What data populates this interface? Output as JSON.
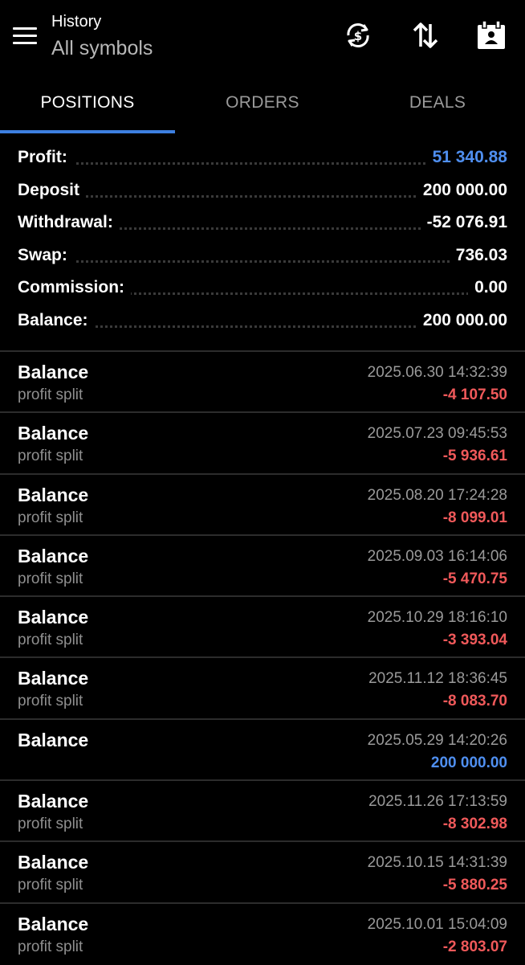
{
  "header": {
    "title": "History",
    "subtitle": "All symbols",
    "icons": [
      "menu-icon",
      "sync-currency-icon",
      "sort-icon",
      "calendar-icon"
    ]
  },
  "tabs": [
    {
      "label": "POSITIONS",
      "active": true
    },
    {
      "label": "ORDERS",
      "active": false
    },
    {
      "label": "DEALS",
      "active": false
    }
  ],
  "summary": {
    "profit": {
      "label": "Profit:",
      "value": "51 340.88"
    },
    "deposit": {
      "label": "Deposit",
      "value": "200 000.00"
    },
    "withdrawal": {
      "label": "Withdrawal:",
      "value": "-52 076.91"
    },
    "swap": {
      "label": "Swap:",
      "value": "736.03"
    },
    "commission": {
      "label": "Commission:",
      "value": "0.00"
    },
    "balance": {
      "label": "Balance:",
      "value": "200 000.00"
    }
  },
  "records": [
    {
      "title": "Balance",
      "sub": "profit split",
      "date": "2025.06.30 14:32:39",
      "amount": "-4 107.50",
      "sign": "neg"
    },
    {
      "title": "Balance",
      "sub": "profit split",
      "date": "2025.07.23 09:45:53",
      "amount": "-5 936.61",
      "sign": "neg"
    },
    {
      "title": "Balance",
      "sub": "profit split",
      "date": "2025.08.20 17:24:28",
      "amount": "-8 099.01",
      "sign": "neg"
    },
    {
      "title": "Balance",
      "sub": "profit split",
      "date": "2025.09.03 16:14:06",
      "amount": "-5 470.75",
      "sign": "neg"
    },
    {
      "title": "Balance",
      "sub": "profit split",
      "date": "2025.10.29 18:16:10",
      "amount": "-3 393.04",
      "sign": "neg"
    },
    {
      "title": "Balance",
      "sub": "profit split",
      "date": "2025.11.12 18:36:45",
      "amount": "-8 083.70",
      "sign": "neg"
    },
    {
      "title": "Balance",
      "sub": "",
      "date": "2025.05.29 14:20:26",
      "amount": "200 000.00",
      "sign": "pos"
    },
    {
      "title": "Balance",
      "sub": "profit split",
      "date": "2025.11.26 17:13:59",
      "amount": "-8 302.98",
      "sign": "neg"
    },
    {
      "title": "Balance",
      "sub": "profit split",
      "date": "2025.10.15 14:31:39",
      "amount": "-5 880.25",
      "sign": "neg"
    },
    {
      "title": "Balance",
      "sub": "profit split",
      "date": "2025.10.01 15:04:09",
      "amount": "-2 803.07",
      "sign": "neg"
    }
  ],
  "colors": {
    "background": "#000000",
    "accent_blue": "#4f8ff0",
    "negative_red": "#f0595a",
    "tab_underline": "#3d7fe0"
  }
}
